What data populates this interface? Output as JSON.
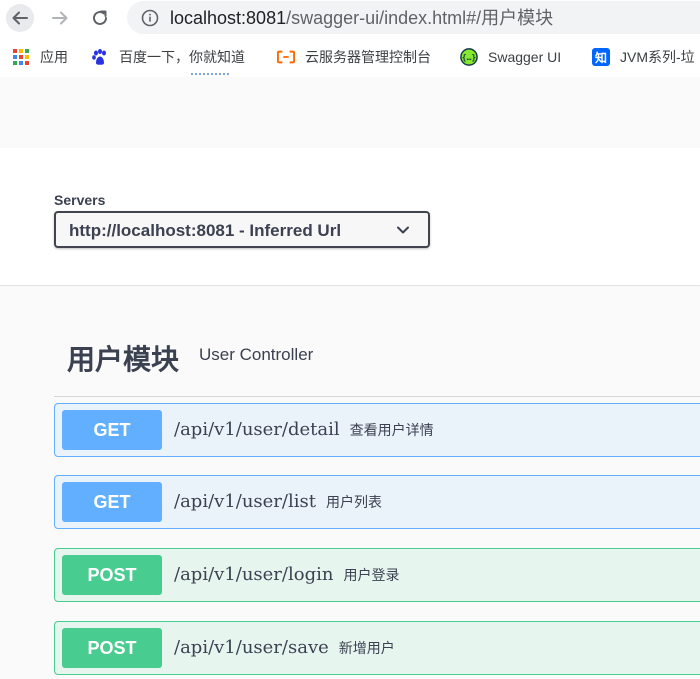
{
  "browser": {
    "url_host": "localhost:8081",
    "url_path": "/swagger-ui/index.html#/用户模块",
    "bookmarks": [
      {
        "label": "应用",
        "icon": "apps-grid-icon"
      },
      {
        "label": "百度一下，你就知道",
        "icon": "baidu-paw-icon"
      },
      {
        "label": "云服务器管理控制台",
        "icon": "aliyun-icon"
      },
      {
        "label": "Swagger UI",
        "icon": "swagger-icon"
      },
      {
        "label": "JVM系列-垃",
        "icon": "zhihu-icon",
        "icon_text": "知"
      }
    ]
  },
  "servers": {
    "label": "Servers",
    "selected": "http://localhost:8081 - Inferred Url"
  },
  "tag": {
    "name": "用户模块",
    "description": "User Controller"
  },
  "operations": [
    {
      "method": "GET",
      "path": "/api/v1/user/detail",
      "summary": "查看用户详情"
    },
    {
      "method": "GET",
      "path": "/api/v1/user/list",
      "summary": "用户列表"
    },
    {
      "method": "POST",
      "path": "/api/v1/user/login",
      "summary": "用户登录"
    },
    {
      "method": "POST",
      "path": "/api/v1/user/save",
      "summary": "新增用户"
    }
  ],
  "colors": {
    "get": "#61affe",
    "post": "#49cc90",
    "text": "#3b4151"
  }
}
